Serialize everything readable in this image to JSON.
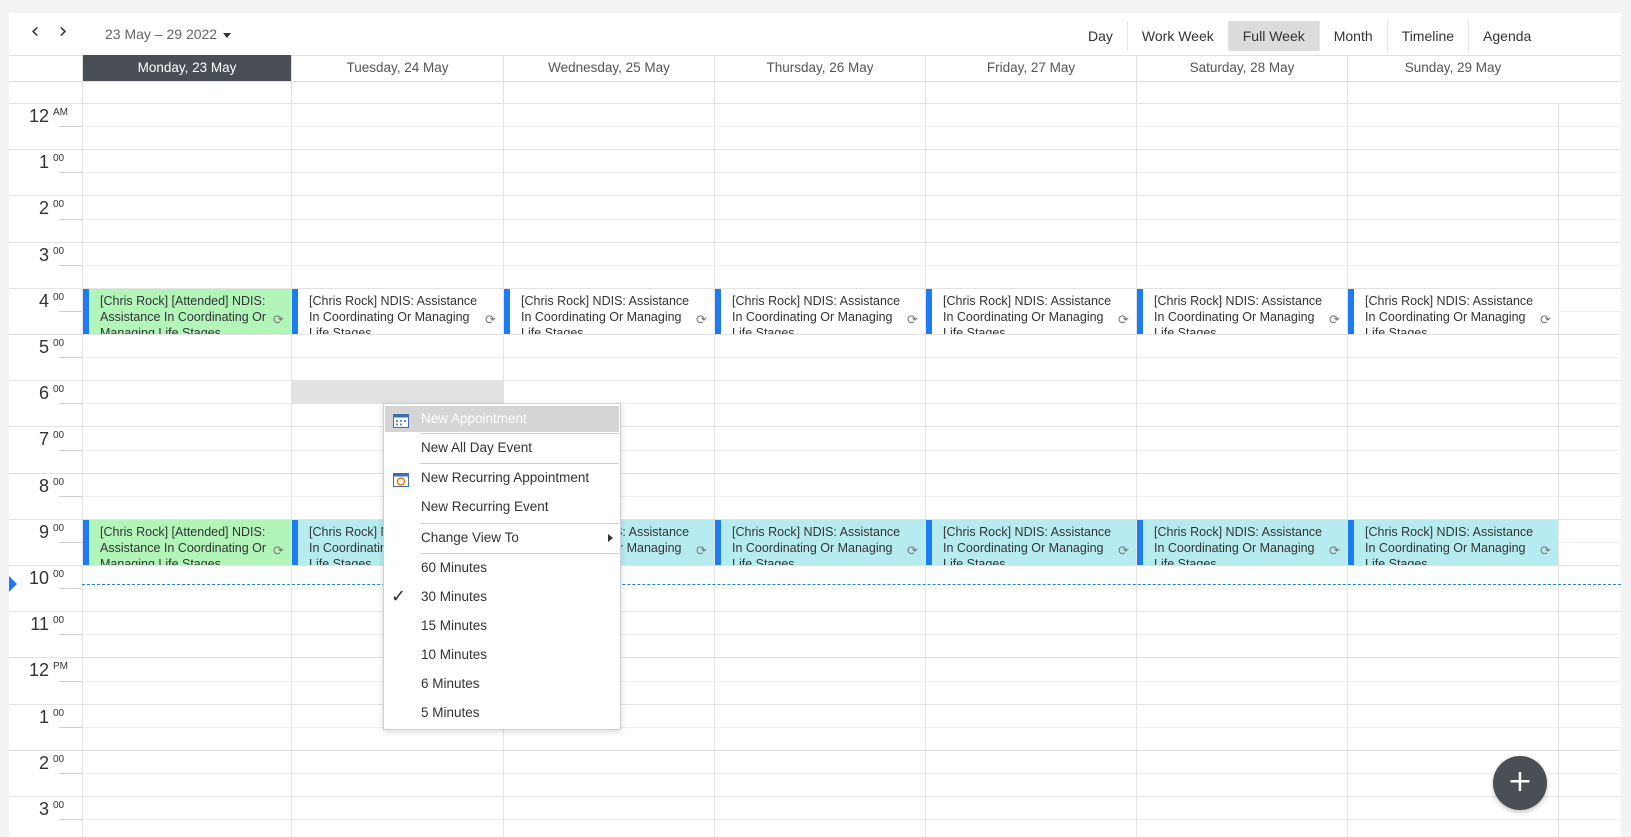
{
  "toolbar": {
    "prev_icon": "chevron-left-icon",
    "next_icon": "chevron-right-icon",
    "prev_glyph": "‹",
    "next_glyph": "›",
    "date_range": "23 May – 29 2022",
    "views": [
      "Day",
      "Work Week",
      "Full Week",
      "Month",
      "Timeline",
      "Agenda"
    ],
    "active_view": "Full Week"
  },
  "days": [
    {
      "label": "Monday, 23 May",
      "today": true
    },
    {
      "label": "Tuesday, 24 May",
      "today": false
    },
    {
      "label": "Wednesday, 25 May",
      "today": false
    },
    {
      "label": "Thursday, 26 May",
      "today": false
    },
    {
      "label": "Friday, 27 May",
      "today": false
    },
    {
      "label": "Saturday, 28 May",
      "today": false
    },
    {
      "label": "Sunday, 29 May",
      "today": false
    }
  ],
  "times": [
    {
      "hour": "12",
      "suffix": "AM"
    },
    {
      "hour": "1",
      "suffix": "00"
    },
    {
      "hour": "2",
      "suffix": "00"
    },
    {
      "hour": "3",
      "suffix": "00"
    },
    {
      "hour": "4",
      "suffix": "00"
    },
    {
      "hour": "5",
      "suffix": "00"
    },
    {
      "hour": "6",
      "suffix": "00"
    },
    {
      "hour": "7",
      "suffix": "00"
    },
    {
      "hour": "8",
      "suffix": "00"
    },
    {
      "hour": "9",
      "suffix": "00"
    },
    {
      "hour": "10",
      "suffix": "00"
    },
    {
      "hour": "11",
      "suffix": "00"
    },
    {
      "hour": "12",
      "suffix": "PM"
    },
    {
      "hour": "1",
      "suffix": "00"
    },
    {
      "hour": "2",
      "suffix": "00"
    },
    {
      "hour": "3",
      "suffix": "00"
    }
  ],
  "appointments": [
    {
      "day": 0,
      "hour": 4,
      "style": "green",
      "text": "[Chris Rock] [Attended] NDIS: Assistance In Coordinating Or Managing Life Stages"
    },
    {
      "day": 1,
      "hour": 4,
      "style": "white",
      "text": "[Chris Rock] NDIS: Assistance In Coordinating Or Managing Life Stages"
    },
    {
      "day": 2,
      "hour": 4,
      "style": "white",
      "text": "[Chris Rock] NDIS: Assistance In Coordinating Or Managing Life Stages"
    },
    {
      "day": 3,
      "hour": 4,
      "style": "white",
      "text": "[Chris Rock] NDIS: Assistance In Coordinating Or Managing Life Stages"
    },
    {
      "day": 4,
      "hour": 4,
      "style": "white",
      "text": "[Chris Rock] NDIS: Assistance In Coordinating Or Managing Life Stages"
    },
    {
      "day": 5,
      "hour": 4,
      "style": "white",
      "text": "[Chris Rock] NDIS: Assistance In Coordinating Or Managing Life Stages"
    },
    {
      "day": 6,
      "hour": 4,
      "style": "white",
      "text": "[Chris Rock] NDIS: Assistance In Coordinating Or Managing Life Stages"
    },
    {
      "day": 0,
      "hour": 9,
      "style": "green",
      "text": "[Chris Rock] [Attended] NDIS: Assistance In Coordinating Or Managing Life Stages"
    },
    {
      "day": 1,
      "hour": 9,
      "style": "cyan",
      "text": "[Chris Rock] NDIS: Assistance In Coordinating Or Managing Life Stages"
    },
    {
      "day": 2,
      "hour": 9,
      "style": "cyan",
      "text": "[Chris Rock] NDIS: Assistance In Coordinating Or Managing Life Stages"
    },
    {
      "day": 3,
      "hour": 9,
      "style": "cyan",
      "text": "[Chris Rock] NDIS: Assistance In Coordinating Or Managing Life Stages"
    },
    {
      "day": 4,
      "hour": 9,
      "style": "cyan",
      "text": "[Chris Rock] NDIS: Assistance In Coordinating Or Managing Life Stages"
    },
    {
      "day": 5,
      "hour": 9,
      "style": "cyan",
      "text": "[Chris Rock] NDIS: Assistance In Coordinating Or Managing Life Stages"
    },
    {
      "day": 6,
      "hour": 9,
      "style": "cyan",
      "text": "[Chris Rock] NDIS: Assistance In Coordinating Or Managing Life Stages"
    }
  ],
  "recurrence_icon": "recurrence-icon",
  "recurrence_glyph": "⟳",
  "context_menu": {
    "items": [
      {
        "label": "New Appointment",
        "icon": "calendar-icon",
        "highlighted": true
      },
      {
        "label": "New All Day Event"
      },
      {
        "label": "New Recurring Appointment",
        "icon": "recurring-calendar-icon"
      },
      {
        "label": "New Recurring Event"
      },
      {
        "label": "Change View To",
        "submenu": true
      },
      {
        "label": "60 Minutes"
      },
      {
        "label": "30 Minutes",
        "checked": true
      },
      {
        "label": "15 Minutes"
      },
      {
        "label": "10 Minutes"
      },
      {
        "label": "6 Minutes"
      },
      {
        "label": "5 Minutes"
      }
    ],
    "check_glyph": "✓"
  },
  "fab": {
    "icon": "plus-icon",
    "glyph": "+"
  },
  "colors": {
    "accent": "#1e7cf2",
    "today_header": "#4a4f55",
    "attended": "#b2f5b8",
    "scheduled": "#b6ecf0",
    "now_line": "#1e88c7"
  }
}
